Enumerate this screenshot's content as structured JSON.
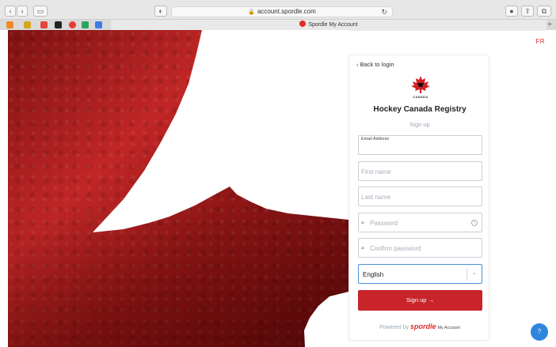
{
  "browser": {
    "url": "account.spordle.com",
    "tab_title": "Spordle My Account",
    "nav_back_icon": "chevron-left-icon",
    "nav_forward_icon": "chevron-right-icon"
  },
  "page": {
    "language_toggle": "FR",
    "card": {
      "back_link": "‹ Back to login",
      "logo_word": "CANADA",
      "title": "Hockey Canada Registry",
      "subtitle": "Sign up",
      "fields": {
        "email": {
          "label": "Email Address",
          "value": ""
        },
        "first_name": {
          "placeholder": "First name"
        },
        "last_name": {
          "placeholder": "Last name"
        },
        "password": {
          "placeholder": "Password"
        },
        "confirm_password": {
          "placeholder": "Confirm password"
        }
      },
      "language_select": {
        "value": "English"
      },
      "signup_button": "Sign up  →",
      "powered_by": "Powered by",
      "powered_brand": "spordle",
      "powered_suffix": "My Account"
    },
    "help_button": "?"
  },
  "colors": {
    "accent_red": "#c8242a",
    "focus_blue": "#4a8fd6",
    "help_blue": "#2f86de"
  }
}
